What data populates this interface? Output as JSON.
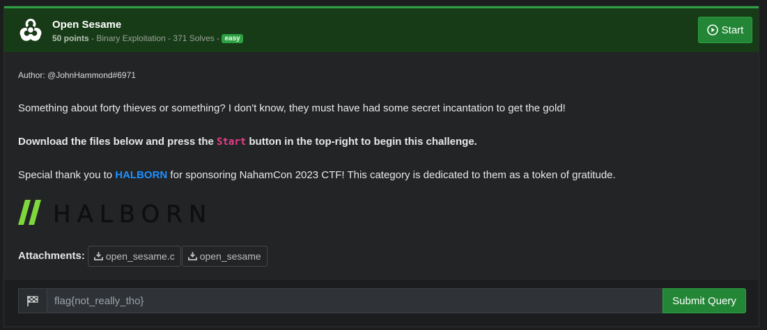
{
  "challenge": {
    "title": "Open Sesame",
    "points": "50 points",
    "meta_rest": " - Binary Exploitation - 371 Solves - ",
    "difficulty": "easy",
    "icon": "biohazard-icon",
    "start_label": "Start"
  },
  "body": {
    "author": "Author: @JohnHammond#6971",
    "description": "Something about forty thieves or something? I don't know, they must have had some secret incantation to get the gold!",
    "instruction_pre": "Download the files below and press the ",
    "instruction_code": "Start",
    "instruction_post": " button in the top-right to begin this challenge.",
    "thanks_pre": "Special thank you to ",
    "thanks_link": "HALBORN",
    "thanks_post": " for sponsoring NahamCon 2023 CTF! This category is dedicated to them as a token of gratitude.",
    "logo_text": "HALBORN"
  },
  "attachments": {
    "label": "Attachments:",
    "files": [
      "open_sesame.c",
      "open_sesame"
    ]
  },
  "flag_form": {
    "placeholder": "flag{not_really_tho}",
    "submit_label": "Submit Query"
  },
  "colors": {
    "accent_green": "#238636",
    "header_bg": "#173b17",
    "code_pink": "#e83e8c",
    "link_blue": "#1e90ff",
    "halborn_green": "#7fd83b"
  }
}
